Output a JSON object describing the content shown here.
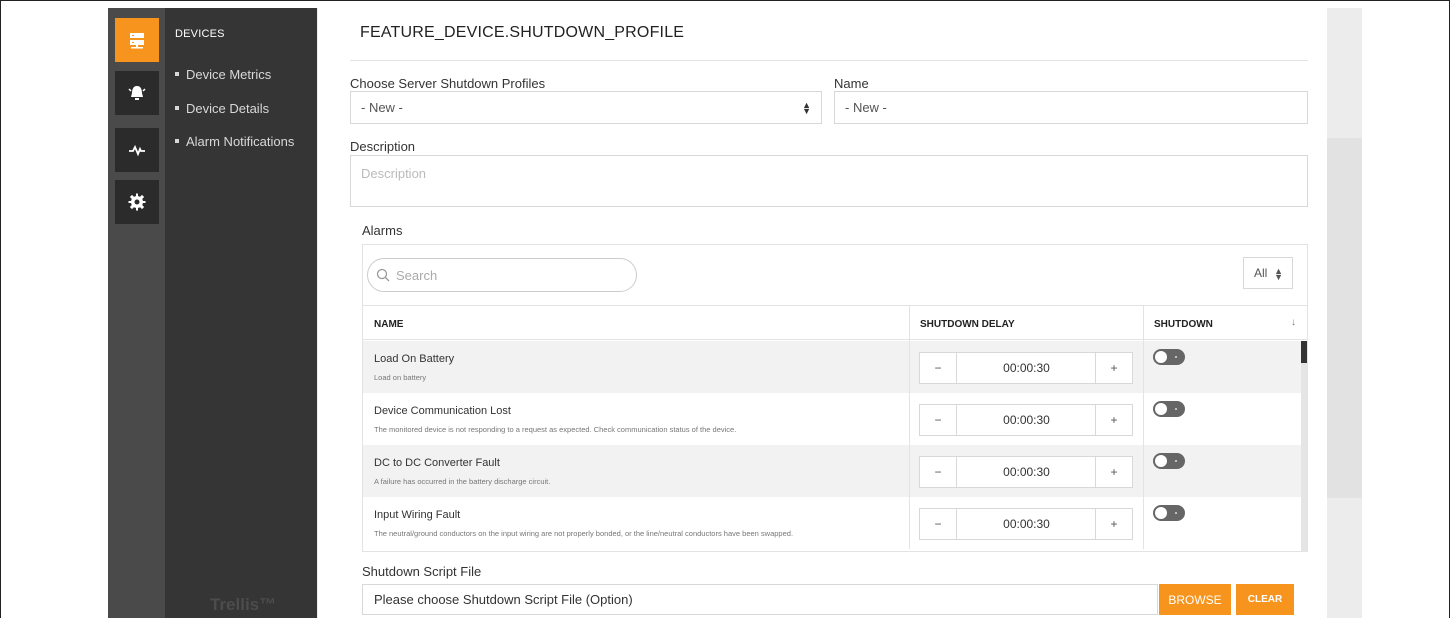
{
  "rail": {
    "icons": [
      "server-icon",
      "alarm-bell-icon",
      "pulse-icon",
      "gear-icon"
    ]
  },
  "nav": {
    "section_title": "DEVICES",
    "items": [
      {
        "label": "Device Metrics"
      },
      {
        "label": "Device Details"
      },
      {
        "label": "Alarm Notifications"
      }
    ],
    "brand": "Trellis™"
  },
  "page": {
    "title": "FEATURE_DEVICE.SHUTDOWN_PROFILE"
  },
  "form": {
    "profiles_label": "Choose Server Shutdown Profiles",
    "profiles_value": "- New -",
    "name_label": "Name",
    "name_value": "- New -",
    "description_label": "Description",
    "description_placeholder": "Description",
    "alarms_label": "Alarms",
    "script_label": "Shutdown Script File",
    "script_placeholder": "Please choose Shutdown Script File (Option)",
    "browse_label": "BROWSE",
    "clear_label": "CLEAR"
  },
  "alarms": {
    "search_placeholder": "Search",
    "filter_value": "All",
    "columns": {
      "name": "NAME",
      "delay": "SHUTDOWN DELAY",
      "shutdown": "SHUTDOWN",
      "sort_icon": "↓"
    },
    "rows": [
      {
        "name": "Load On Battery",
        "description": "Load on battery",
        "delay": "00:00:30",
        "shutdown": false
      },
      {
        "name": "Device Communication Lost",
        "description": "The monitored device is not responding to a request as expected. Check communication status of the device.",
        "delay": "00:00:30",
        "shutdown": false
      },
      {
        "name": "DC to DC Converter Fault",
        "description": "A failure has occurred in the battery discharge circuit.",
        "delay": "00:00:30",
        "shutdown": false
      },
      {
        "name": "Input Wiring Fault",
        "description": "The neutral/ground conductors on the input wiring are not properly bonded, or the line/neutral conductors have been swapped.",
        "delay": "00:00:30",
        "shutdown": false
      }
    ],
    "stepper": {
      "minus": "−",
      "plus": "+"
    }
  },
  "colors": {
    "accent": "#f7941d",
    "rail_bg": "#4a4a4a",
    "nav_bg": "#353535"
  }
}
